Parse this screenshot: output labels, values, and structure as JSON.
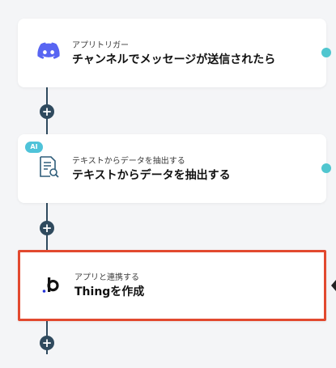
{
  "steps": [
    {
      "subtitle": "アプリトリガー",
      "title": "チャンネルでメッセージが送信されたら",
      "icon": "discord-icon"
    },
    {
      "subtitle": "テキストからデータを抽出する",
      "title": "テキストからデータを抽出する",
      "icon": "document-search-icon",
      "badge": "AI"
    },
    {
      "subtitle": "アプリと連携する",
      "title": "Thingを作成",
      "icon": "bubble-icon"
    }
  ],
  "add_step_label": "+",
  "colors": {
    "accent": "#2f4a5e",
    "selected_border": "#e2492f",
    "ai_badge": "#4fc3d9",
    "discord": "#5865F2",
    "edge_dot": "#50c6cf"
  }
}
